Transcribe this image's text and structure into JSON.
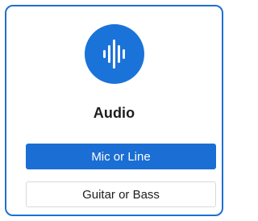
{
  "card": {
    "title": "Audio",
    "icon": "audio-waveform-icon",
    "accent_color": "#1a73d9"
  },
  "buttons": {
    "primary_label": "Mic or Line",
    "secondary_label": "Guitar or Bass"
  }
}
